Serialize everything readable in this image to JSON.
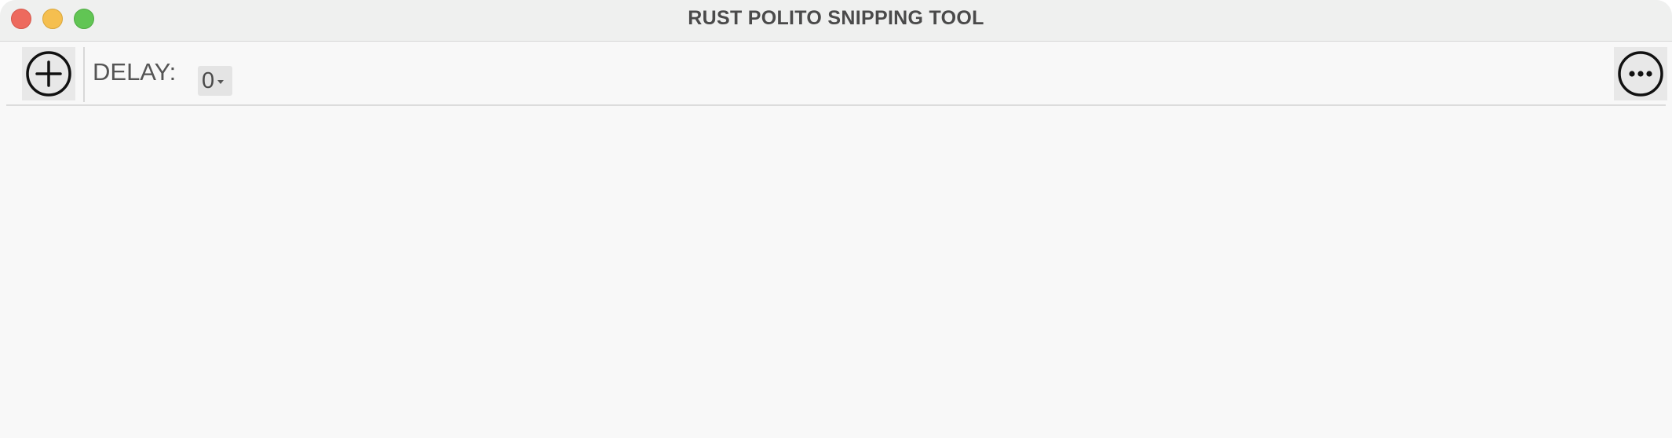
{
  "window": {
    "title": "RUST POLITO SNIPPING TOOL"
  },
  "titlebar": {
    "buttons": [
      {
        "name": "close",
        "color": "#ed6a5e"
      },
      {
        "name": "minimize",
        "color": "#f5bf4f"
      },
      {
        "name": "zoom",
        "color": "#61c554"
      }
    ]
  },
  "toolbar": {
    "add_icon": "plus-circle-icon",
    "delay_label": "DELAY:",
    "delay_value": "0",
    "more_icon": "ellipsis-circle-icon"
  }
}
